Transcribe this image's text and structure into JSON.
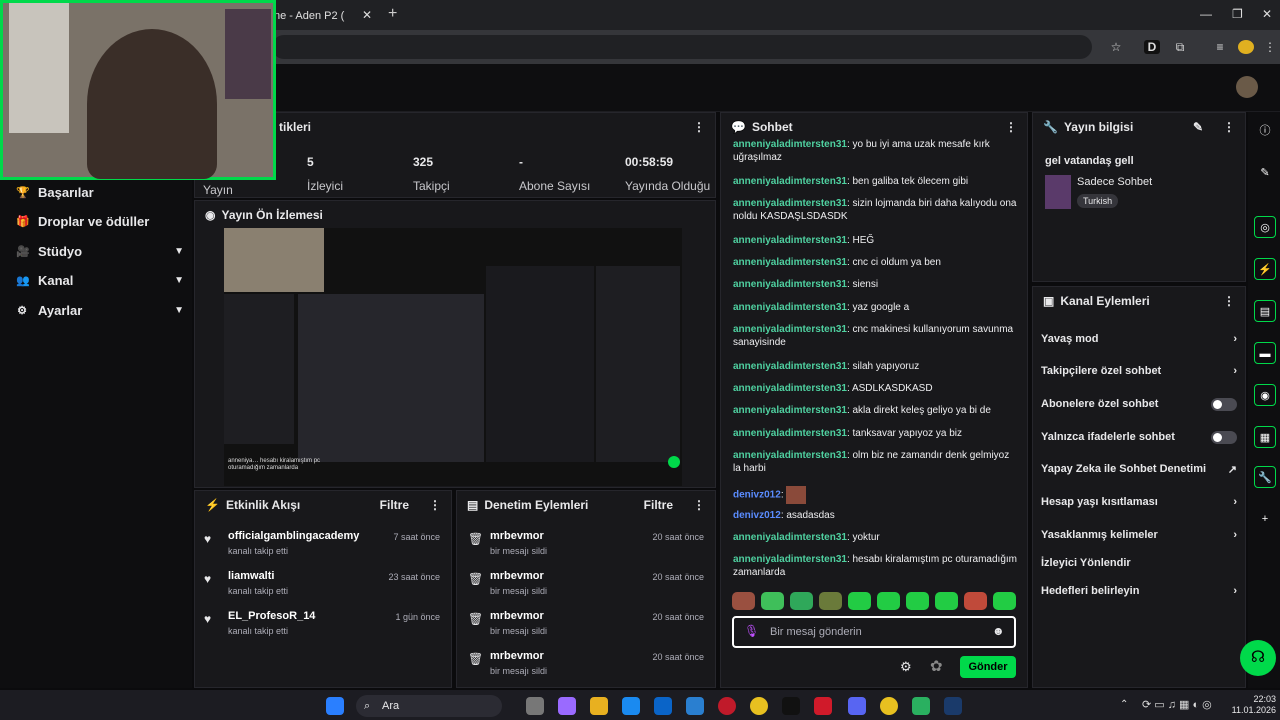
{
  "browser": {
    "tab_title": "ne - Aden P2 (",
    "new_tab": "+",
    "close": "✕",
    "win_min": "—",
    "win_max": "❐",
    "win_close": "✕"
  },
  "sidebar": {
    "items": [
      {
        "label": "Başarılar",
        "icon": "trophy-icon",
        "glyph": "🏆"
      },
      {
        "label": "Droplar ve ödüller",
        "icon": "gift-icon",
        "glyph": "🎁"
      },
      {
        "label": "Stüdyo",
        "icon": "studio-icon",
        "glyph": "🎥",
        "chev": "⌄"
      },
      {
        "label": "Kanal",
        "icon": "users-icon",
        "glyph": "👥",
        "chev": "⌄"
      },
      {
        "label": "Ayarlar",
        "icon": "gear-icon",
        "glyph": "⚙",
        "chev": "⌄"
      }
    ]
  },
  "stats": {
    "title": "tikleri",
    "items": [
      {
        "value": "",
        "label": "Yayın"
      },
      {
        "value": "5",
        "label": "İzleyici"
      },
      {
        "value": "325",
        "label": "Takipçi"
      },
      {
        "value": "-",
        "label": "Abone Sayısı"
      },
      {
        "value": "00:58:59",
        "label": "Yayında Olduğu"
      }
    ]
  },
  "preview": {
    "title": "Yayın Ön İzlemesi",
    "overlay_text": "anneniya… hesabı kiralamıştım pc oturamadığım zamanlarda"
  },
  "activity": {
    "title": "Etkinlik Akışı",
    "filter": "Filtre",
    "rows": [
      {
        "name": "officialgamblingacademy",
        "sub": "kanalı takip etti",
        "time": "7 saat önce"
      },
      {
        "name": "liamwalti",
        "sub": "kanalı takip etti",
        "time": "23 saat önce"
      },
      {
        "name": "EL_ProfesoR_14",
        "sub": "kanalı takip etti",
        "time": "1 gün önce"
      }
    ]
  },
  "moderation": {
    "title": "Denetim Eylemleri",
    "filter": "Filtre",
    "rows": [
      {
        "name": "mrbevmor",
        "sub": "bir mesajı sildi",
        "time": "20 saat önce"
      },
      {
        "name": "mrbevmor",
        "sub": "bir mesajı sildi",
        "time": "20 saat önce"
      },
      {
        "name": "mrbevmor",
        "sub": "bir mesajı sildi",
        "time": "20 saat önce"
      },
      {
        "name": "mrbevmor",
        "sub": "bir mesajı sildi",
        "time": "20 saat önce"
      }
    ]
  },
  "chat": {
    "title": "Sohbet",
    "placeholder": "Bir mesaj gönderin",
    "send": "Gönder",
    "messages": [
      {
        "user": "anneniyaladimtersten31",
        "text": "yo bu iyi ama uzak mesafe kırk uğraşılmaz",
        "alt": false
      },
      {
        "user": "anneniyaladimtersten31",
        "text": "ben galiba tek ölecem gibi",
        "alt": false
      },
      {
        "user": "anneniyaladimtersten31",
        "text": "sizin lojmanda biri daha kalıyodu ona noldu KASDAŞLSDASDK",
        "alt": false
      },
      {
        "user": "anneniyaladimtersten31",
        "text": "HEĞ",
        "alt": false
      },
      {
        "user": "anneniyaladimtersten31",
        "text": "cnc ci oldum ya ben",
        "alt": false
      },
      {
        "user": "anneniyaladimtersten31",
        "text": "siensi",
        "alt": false
      },
      {
        "user": "anneniyaladimtersten31",
        "text": "yaz google a",
        "alt": false
      },
      {
        "user": "anneniyaladimtersten31",
        "text": "cnc makinesi kullanıyorum savunma sanayisinde",
        "alt": false
      },
      {
        "user": "anneniyaladimtersten31",
        "text": "silah yapıyoruz",
        "alt": false
      },
      {
        "user": "anneniyaladimtersten31",
        "text": "ASDLKASDKASD",
        "alt": false
      },
      {
        "user": "anneniyaladimtersten31",
        "text": "akla direkt keleş geliyo ya bi de",
        "alt": false
      },
      {
        "user": "anneniyaladimtersten31",
        "text": "tanksavar yapıyoz ya biz",
        "alt": false
      },
      {
        "user": "anneniyaladimtersten31",
        "text": "olm biz ne zamandır denk gelmiyoz la harbi",
        "alt": false
      },
      {
        "user": "denivz012",
        "text": "",
        "alt": true
      },
      {
        "user": "denivz012",
        "text": "asadasdas",
        "alt": true
      },
      {
        "user": "anneniyaladimtersten31",
        "text": "yoktur",
        "alt": false
      },
      {
        "user": "anneniyaladimtersten31",
        "text": "hesabı kiralamıştım pc oturamadığım zamanlarda",
        "alt": false
      }
    ]
  },
  "info": {
    "title": "Yayın bilgisi",
    "stream_title": "gel vatandaş gell",
    "category": "Sadece Sohbet",
    "tag": "Turkish"
  },
  "actions": {
    "title": "Kanal Eylemleri",
    "items": [
      {
        "label": "Yavaş mod",
        "kind": "chev"
      },
      {
        "label": "Takipçilere özel sohbet",
        "kind": "chev"
      },
      {
        "label": "Abonelere özel sohbet",
        "kind": "toggle"
      },
      {
        "label": "Yalnızca ifadelerle sohbet",
        "kind": "toggle"
      },
      {
        "label": "Yapay Zeka ile Sohbet Denetimi",
        "kind": "ext"
      },
      {
        "label": "Hesap yaşı kısıtlaması",
        "kind": "chev"
      },
      {
        "label": "Yasaklanmış kelimeler",
        "kind": "chev"
      },
      {
        "label": "İzleyici Yönlendir",
        "kind": "none"
      },
      {
        "label": "Hedefleri belirleyin",
        "kind": "chev"
      }
    ]
  },
  "taskbar": {
    "search": "Ara",
    "time": "22:03",
    "date": "11.01.2026"
  },
  "colors": {
    "accent": "#00d94a",
    "chat_user": "#4fd0a0",
    "chat_user_alt": "#5a8cff"
  }
}
